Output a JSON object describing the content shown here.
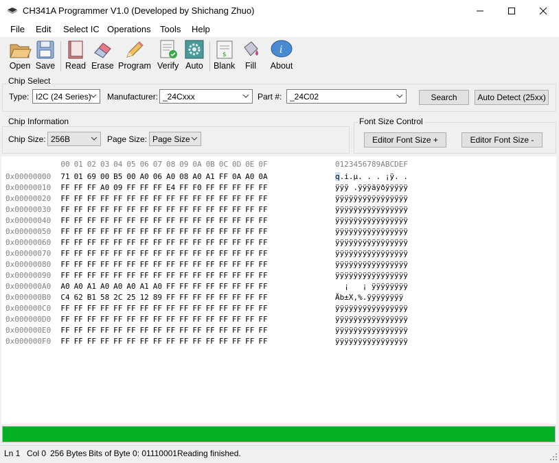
{
  "window": {
    "title": "CH341A Programmer V1.0 (Developed by Shichang Zhuo)"
  },
  "menu": [
    "File",
    "Edit",
    "Select IC",
    "Operations",
    "Tools",
    "Help"
  ],
  "toolbar": {
    "open": "Open",
    "save": "Save",
    "read": "Read",
    "erase": "Erase",
    "program": "Program",
    "verify": "Verify",
    "auto": "Auto",
    "blank": "Blank",
    "fill": "Fill",
    "about": "About"
  },
  "chip_select": {
    "title": "Chip Select",
    "type_label": "Type:",
    "type_value": "I2C (24 Series)",
    "manufacturer_label": "Manufacturer:",
    "manufacturer_value": "_24Cxxx",
    "part_label": "Part #:",
    "part_value": "_24C02",
    "search_label": "Search",
    "auto_detect_label": "Auto Detect (25xx)"
  },
  "chip_info": {
    "title": "Chip Information",
    "size_label": "Chip Size:",
    "size_value": "256B",
    "page_label": "Page Size:",
    "page_value": "Page Size"
  },
  "font_size": {
    "title": "Font Size Control",
    "inc_label": "Editor Font Size +",
    "dec_label": "Editor Font Size -"
  },
  "hex": {
    "col_headers": [
      "00",
      "01",
      "02",
      "03",
      "04",
      "05",
      "06",
      "07",
      "08",
      "09",
      "0A",
      "0B",
      "0C",
      "0D",
      "0E",
      "0F"
    ],
    "ascii_header": "0123456789ABCDEF",
    "rows": [
      {
        "addr": "0x00000000",
        "bytes": [
          "71",
          "01",
          "69",
          "00",
          "B5",
          "00",
          "A0",
          "06",
          "A0",
          "08",
          "A0",
          "A1",
          "FF",
          "0A",
          "A0",
          "0A"
        ],
        "ascii": "q.i.µ. . . ¡ÿ. ."
      },
      {
        "addr": "0x00000010",
        "bytes": [
          "FF",
          "FF",
          "FF",
          "A0",
          "09",
          "FF",
          "FF",
          "FF",
          "E4",
          "FF",
          "F0",
          "FF",
          "FF",
          "FF",
          "FF",
          "FF"
        ],
        "ascii": "ÿÿÿ .ÿÿÿäÿðÿÿÿÿÿ"
      },
      {
        "addr": "0x00000020",
        "bytes": [
          "FF",
          "FF",
          "FF",
          "FF",
          "FF",
          "FF",
          "FF",
          "FF",
          "FF",
          "FF",
          "FF",
          "FF",
          "FF",
          "FF",
          "FF",
          "FF"
        ],
        "ascii": "ÿÿÿÿÿÿÿÿÿÿÿÿÿÿÿÿ"
      },
      {
        "addr": "0x00000030",
        "bytes": [
          "FF",
          "FF",
          "FF",
          "FF",
          "FF",
          "FF",
          "FF",
          "FF",
          "FF",
          "FF",
          "FF",
          "FF",
          "FF",
          "FF",
          "FF",
          "FF"
        ],
        "ascii": "ÿÿÿÿÿÿÿÿÿÿÿÿÿÿÿÿ"
      },
      {
        "addr": "0x00000040",
        "bytes": [
          "FF",
          "FF",
          "FF",
          "FF",
          "FF",
          "FF",
          "FF",
          "FF",
          "FF",
          "FF",
          "FF",
          "FF",
          "FF",
          "FF",
          "FF",
          "FF"
        ],
        "ascii": "ÿÿÿÿÿÿÿÿÿÿÿÿÿÿÿÿ"
      },
      {
        "addr": "0x00000050",
        "bytes": [
          "FF",
          "FF",
          "FF",
          "FF",
          "FF",
          "FF",
          "FF",
          "FF",
          "FF",
          "FF",
          "FF",
          "FF",
          "FF",
          "FF",
          "FF",
          "FF"
        ],
        "ascii": "ÿÿÿÿÿÿÿÿÿÿÿÿÿÿÿÿ"
      },
      {
        "addr": "0x00000060",
        "bytes": [
          "FF",
          "FF",
          "FF",
          "FF",
          "FF",
          "FF",
          "FF",
          "FF",
          "FF",
          "FF",
          "FF",
          "FF",
          "FF",
          "FF",
          "FF",
          "FF"
        ],
        "ascii": "ÿÿÿÿÿÿÿÿÿÿÿÿÿÿÿÿ"
      },
      {
        "addr": "0x00000070",
        "bytes": [
          "FF",
          "FF",
          "FF",
          "FF",
          "FF",
          "FF",
          "FF",
          "FF",
          "FF",
          "FF",
          "FF",
          "FF",
          "FF",
          "FF",
          "FF",
          "FF"
        ],
        "ascii": "ÿÿÿÿÿÿÿÿÿÿÿÿÿÿÿÿ"
      },
      {
        "addr": "0x00000080",
        "bytes": [
          "FF",
          "FF",
          "FF",
          "FF",
          "FF",
          "FF",
          "FF",
          "FF",
          "FF",
          "FF",
          "FF",
          "FF",
          "FF",
          "FF",
          "FF",
          "FF"
        ],
        "ascii": "ÿÿÿÿÿÿÿÿÿÿÿÿÿÿÿÿ"
      },
      {
        "addr": "0x00000090",
        "bytes": [
          "FF",
          "FF",
          "FF",
          "FF",
          "FF",
          "FF",
          "FF",
          "FF",
          "FF",
          "FF",
          "FF",
          "FF",
          "FF",
          "FF",
          "FF",
          "FF"
        ],
        "ascii": "ÿÿÿÿÿÿÿÿÿÿÿÿÿÿÿÿ"
      },
      {
        "addr": "0x000000A0",
        "bytes": [
          "A0",
          "A0",
          "A1",
          "A0",
          "A0",
          "A0",
          "A1",
          "A0",
          "FF",
          "FF",
          "FF",
          "FF",
          "FF",
          "FF",
          "FF",
          "FF"
        ],
        "ascii": "  ¡   ¡ ÿÿÿÿÿÿÿÿ"
      },
      {
        "addr": "0x000000B0",
        "bytes": [
          "C4",
          "62",
          "B1",
          "58",
          "2C",
          "25",
          "12",
          "89",
          "FF",
          "FF",
          "FF",
          "FF",
          "FF",
          "FF",
          "FF",
          "FF"
        ],
        "ascii": "Äb±X,%.ÿÿÿÿÿÿÿÿ"
      },
      {
        "addr": "0x000000C0",
        "bytes": [
          "FF",
          "FF",
          "FF",
          "FF",
          "FF",
          "FF",
          "FF",
          "FF",
          "FF",
          "FF",
          "FF",
          "FF",
          "FF",
          "FF",
          "FF",
          "FF"
        ],
        "ascii": "ÿÿÿÿÿÿÿÿÿÿÿÿÿÿÿÿ"
      },
      {
        "addr": "0x000000D0",
        "bytes": [
          "FF",
          "FF",
          "FF",
          "FF",
          "FF",
          "FF",
          "FF",
          "FF",
          "FF",
          "FF",
          "FF",
          "FF",
          "FF",
          "FF",
          "FF",
          "FF"
        ],
        "ascii": "ÿÿÿÿÿÿÿÿÿÿÿÿÿÿÿÿ"
      },
      {
        "addr": "0x000000E0",
        "bytes": [
          "FF",
          "FF",
          "FF",
          "FF",
          "FF",
          "FF",
          "FF",
          "FF",
          "FF",
          "FF",
          "FF",
          "FF",
          "FF",
          "FF",
          "FF",
          "FF"
        ],
        "ascii": "ÿÿÿÿÿÿÿÿÿÿÿÿÿÿÿÿ"
      },
      {
        "addr": "0x000000F0",
        "bytes": [
          "FF",
          "FF",
          "FF",
          "FF",
          "FF",
          "FF",
          "FF",
          "FF",
          "FF",
          "FF",
          "FF",
          "FF",
          "FF",
          "FF",
          "FF",
          "FF"
        ],
        "ascii": "ÿÿÿÿÿÿÿÿÿÿÿÿÿÿÿÿ"
      }
    ]
  },
  "progress": {
    "fraction": 1.0,
    "color": "#06b025"
  },
  "status": {
    "ln": "Ln 1",
    "col": "Col 0",
    "size": "256 Bytes",
    "bits": "Bits of Byte 0: 01110001",
    "message": "Reading finished."
  }
}
